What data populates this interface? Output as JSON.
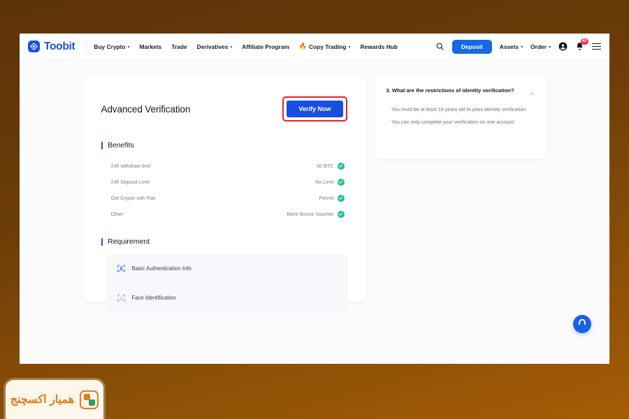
{
  "brand": {
    "name": "Toobit",
    "logo_icon": "toobit-diamond-logo",
    "color": "#1b53d6"
  },
  "nav": {
    "items": [
      {
        "label": "Buy Crypto",
        "has_caret": true,
        "icon": null
      },
      {
        "label": "Markets",
        "has_caret": false,
        "icon": null
      },
      {
        "label": "Trade",
        "has_caret": false,
        "icon": null
      },
      {
        "label": "Derivatives",
        "has_caret": true,
        "icon": null
      },
      {
        "label": "Affiliate Program",
        "has_caret": false,
        "icon": null
      },
      {
        "label": "Copy Trading",
        "has_caret": true,
        "icon": "flame-icon"
      },
      {
        "label": "Rewards Hub",
        "has_caret": false,
        "icon": null
      }
    ],
    "search_icon": "search-icon",
    "deposit_label": "Deposit",
    "assets_label": "Assets",
    "order_label": "Order",
    "account_icon": "user-avatar-icon",
    "notification_icon": "bell-icon",
    "notification_count": "42",
    "menu_icon": "hamburger-menu-icon",
    "caret_glyph": "▾",
    "flame_glyph": "🔥"
  },
  "card": {
    "title": "Advanced Verification",
    "verify_button": "Verify Now",
    "highlight_color": "#e8202a",
    "benefits_title": "Benefits",
    "benefits": [
      {
        "label": "24h withdraw limit",
        "value": "50 BTC",
        "status_icon": "green-check-icon"
      },
      {
        "label": "24h Deposit Limit",
        "value": "No Limit",
        "status_icon": "green-check-icon"
      },
      {
        "label": "Get Crypto with Fiat",
        "value": "Permit",
        "status_icon": "green-check-icon"
      },
      {
        "label": "Other",
        "value": "More Bonus Voucher",
        "status_icon": "green-check-icon"
      }
    ],
    "requirement_title": "Requirement",
    "requirements": [
      {
        "label": "Basic Authentication Info",
        "icon": "basic-auth-person-icon"
      },
      {
        "label": "Face Identification",
        "icon": "face-scan-icon"
      }
    ]
  },
  "faq": {
    "question": "3. What are the restrictions of identity verification?",
    "toggle_icon": "chevron-up-icon",
    "bullet": "·",
    "answers": [
      "You must be at least 18 years old to pass identity verification",
      "You can only complete your verification on one account"
    ]
  },
  "support": {
    "icon": "headset-support-icon",
    "color": "#1862e0"
  },
  "watermark": {
    "text": "همیار اکسچنج",
    "logo_icon": "hamyar-exchange-logo",
    "color": "#e07d1c"
  }
}
